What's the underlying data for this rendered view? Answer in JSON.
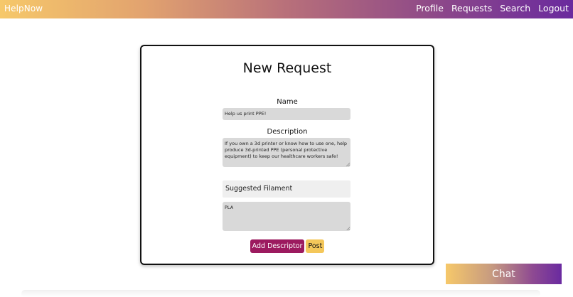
{
  "header": {
    "brand": "HelpNow",
    "nav": [
      "Profile",
      "Requests",
      "Search",
      "Logout"
    ]
  },
  "form": {
    "title": "New Request",
    "name_label": "Name",
    "name_value": "Help us print PPE!",
    "description_label": "Description",
    "description_value": "If you own a 3d printer or know how to use one, help produce 3d-printed PPE (personal protective equipment) to keep our healthcare workers safe!",
    "descriptor_name": "Suggested Filament",
    "descriptor_value": "PLA",
    "add_descriptor_label": "Add Descriptor",
    "post_label": "Post"
  },
  "chat": {
    "label": "Chat"
  },
  "colors": {
    "gradient_start": "#f6c86a",
    "gradient_end": "#6a2a9e",
    "add_button": "#9c1a5f",
    "post_button": "#f4c75a"
  }
}
